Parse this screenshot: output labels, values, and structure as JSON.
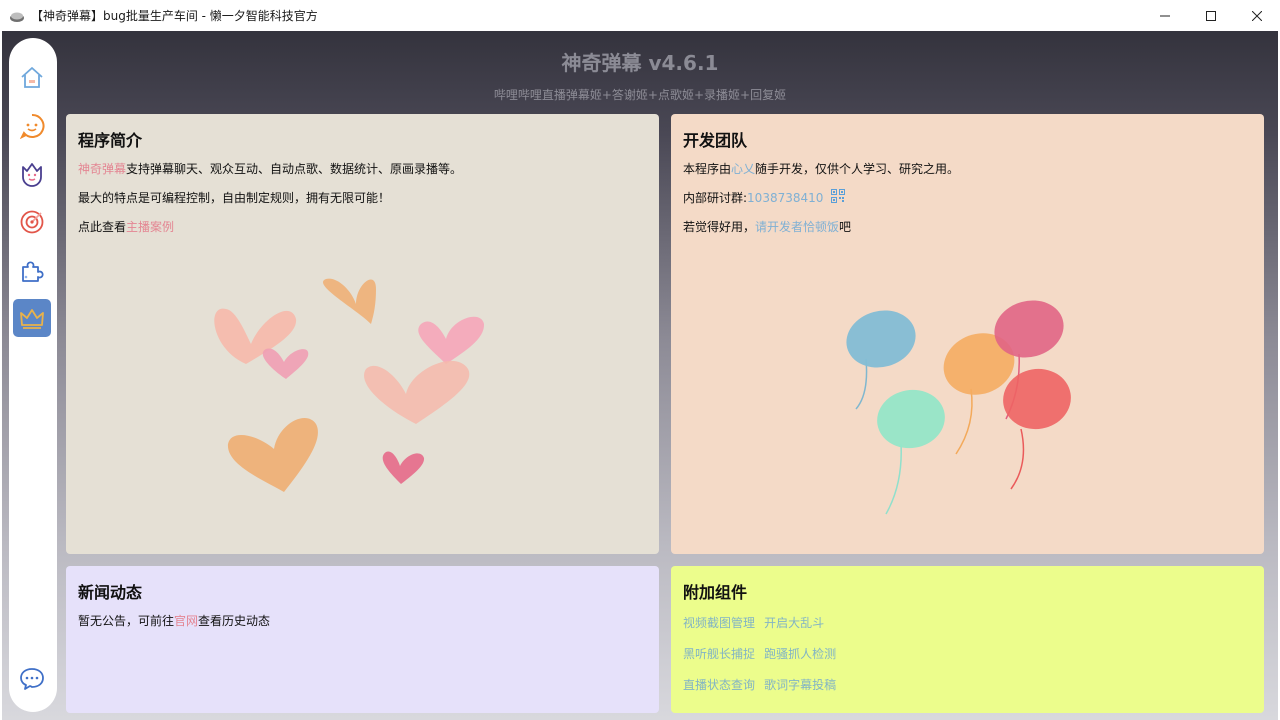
{
  "window": {
    "title": "【神奇弹幕】bug批量生产车间 - 懒一夕智能科技官方"
  },
  "header": {
    "title": "神奇弹幕 v4.6.1",
    "subtitle": "哔哩哔哩直播弹幕姬+答谢姬+点歌姬+录播姬+回复姬"
  },
  "sidebar": {
    "items": [
      {
        "icon": "home-icon",
        "active": false
      },
      {
        "icon": "chat-bubble-icon",
        "active": false
      },
      {
        "icon": "flower-face-icon",
        "active": false
      },
      {
        "icon": "target-icon",
        "active": false
      },
      {
        "icon": "puzzle-icon",
        "active": false
      },
      {
        "icon": "crown-icon",
        "active": true
      }
    ],
    "bottom_icon": "feedback-chat-icon"
  },
  "intro": {
    "title": "程序简介",
    "line1_link": "神奇弹幕",
    "line1_text": "支持弹幕聊天、观众互动、自动点歌、数据统计、原画录播等。",
    "line2": "最大的特点是可编程控制，自由制定规则，拥有无限可能！",
    "line3_text": "点此查看",
    "line3_link": "主播案例"
  },
  "team": {
    "title": "开发团队",
    "line1_a": "本程序由",
    "line1_link": "心乂",
    "line1_b": "随手开发，仅供个人学习、研究之用。",
    "line2_label": "内部研讨群: ",
    "line2_value": "1038738410",
    "line3_a": "若觉得好用，",
    "line3_link": "请开发者恰顿饭",
    "line3_b": "吧"
  },
  "news": {
    "title": "新闻动态",
    "text_a": "暂无公告，可前往",
    "link": "官网",
    "text_b": "查看历史动态"
  },
  "addons": {
    "title": "附加组件",
    "rows": [
      [
        "视频截图管理",
        "开启大乱斗"
      ],
      [
        "黑听舰长捕捉",
        "跑骚抓人检测"
      ],
      [
        "直播状态查询",
        "歌词字幕投稿"
      ]
    ]
  },
  "colors": {
    "accent_pink": "#e48592",
    "accent_blue": "#7fb0d4",
    "active_nav": "#5b86c7",
    "card_intro": "#e5e0d5",
    "card_team": "#f4dac7",
    "card_news": "#e6e1fa",
    "card_addon": "#ecfd8c"
  }
}
